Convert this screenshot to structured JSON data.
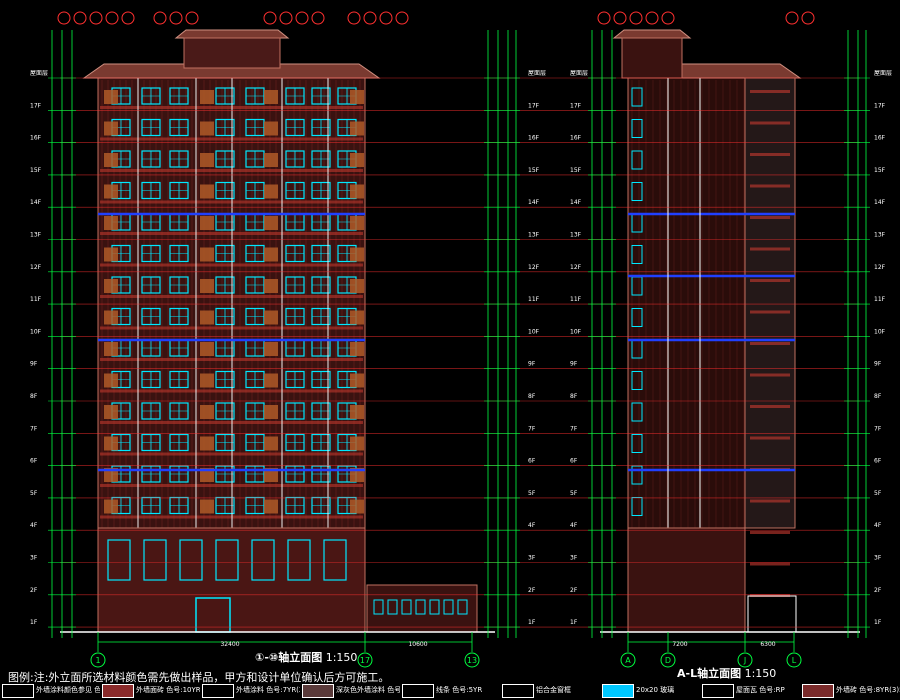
{
  "drawing": {
    "left_elevation": {
      "title": "①-⑩轴立面图",
      "scale": "1:150",
      "axis_labels": [
        "1",
        "17",
        "13"
      ]
    },
    "right_elevation": {
      "title": "A-L轴立面图",
      "scale": "1:150",
      "axis_labels": [
        "A",
        "D",
        "J",
        "L"
      ]
    },
    "floor_labels": [
      "屋面层",
      "17F",
      "16F",
      "15F",
      "14F",
      "13F",
      "12F",
      "11F",
      "10F",
      "9F",
      "8F",
      "7F",
      "6F",
      "5F",
      "4F",
      "3F",
      "2F",
      "1F"
    ],
    "dims": {
      "bottom_left": "32400",
      "bottom_mid": "10600",
      "bottom_right_a": "7200",
      "bottom_right_b": "6300"
    }
  },
  "notes": {
    "main": "图例:注:外立面所选材料颜色需先做出样品，甲方和设计单位确认后方可施工。"
  },
  "legend": [
    {
      "label": "外墙涂料颜色参见 色号:8YR(3)",
      "swatch": "#000000"
    },
    {
      "label": "外墙面砖 色号:10YR(1)",
      "swatch": "#8a2a2a"
    },
    {
      "label": "外墙涂料 色号:7YR(2)",
      "swatch": "#000000"
    },
    {
      "label": "深灰色外墙涂料 色号:8YR(3)",
      "swatch": "#5a3a3a"
    },
    {
      "label": "线条 色号:5YR",
      "swatch": "#000000"
    },
    {
      "label": "铝合金窗框",
      "swatch": "#000000"
    },
    {
      "label": "20x20 玻璃",
      "swatch": "#00c8ff"
    },
    {
      "label": "屋面瓦 色号:RP",
      "swatch": "#000000"
    },
    {
      "label": "外墙砖 色号:8YR(3)5",
      "swatch": "#7a2a2a"
    }
  ],
  "colors": {
    "grid_red": "#ff3030",
    "dim_green": "#00ff40",
    "window_cyan": "#00e8ff",
    "wall_red": "#a63a30",
    "balcony_brown": "#b05a28",
    "bg": "#000000",
    "text_white": "#ffffff",
    "band_blue": "#2040ff"
  }
}
